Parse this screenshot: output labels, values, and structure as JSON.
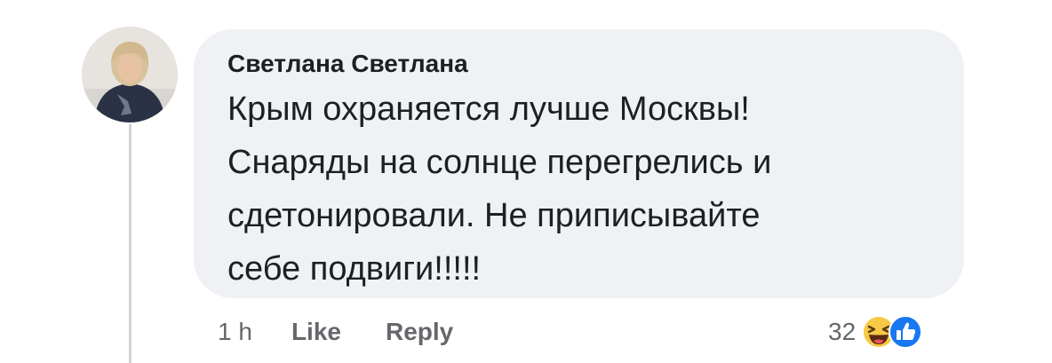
{
  "comment": {
    "author": "Светлана Светлана",
    "lines": [
      "Крым охраняется лучше Москвы!",
      "Снаряды на солнце перегрелись и",
      "сдетонировали. Не приписывайте",
      "себе подвиги!!!!!"
    ],
    "timestamp": "1 h",
    "like_label": "Like",
    "reply_label": "Reply",
    "reaction_count": "32",
    "reactions": [
      "haha-icon",
      "like-icon"
    ]
  },
  "colors": {
    "bubble": "#eff1f4",
    "text": "#1d1f23",
    "muted": "#65676b",
    "like_blue": "#1877f2",
    "haha_yellow": "#f7c944"
  }
}
